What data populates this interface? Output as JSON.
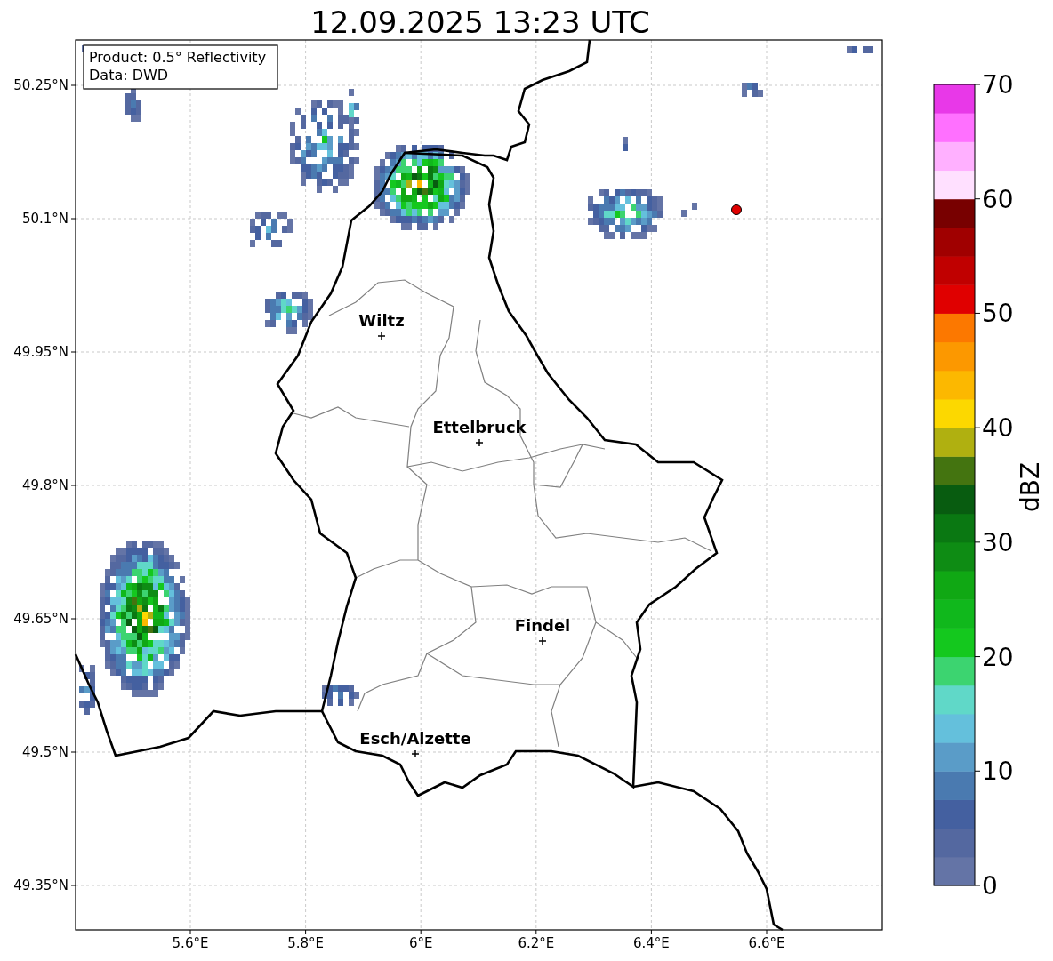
{
  "title": "12.09.2025 13:23 UTC",
  "info_box": [
    "Product: 0.5° Reflectivity",
    "Data: DWD"
  ],
  "map": {
    "xticks": [
      "5.6°E",
      "5.8°E",
      "6°E",
      "6.2°E",
      "6.4°E",
      "6.6°E"
    ],
    "yticks": [
      "50.25°N",
      "50.1°N",
      "49.95°N",
      "49.8°N",
      "49.65°N",
      "49.5°N",
      "49.35°N"
    ],
    "cities": [
      {
        "name": "Wiltz"
      },
      {
        "name": "Ettelbruck"
      },
      {
        "name": "Findel"
      },
      {
        "name": "Esch/Alzette"
      }
    ],
    "radar_site": {
      "color": "#e00000"
    }
  },
  "colorbar": {
    "label": "dBZ",
    "ticks": [
      "70",
      "60",
      "50",
      "40",
      "30",
      "20",
      "10",
      "0"
    ],
    "bins": [
      {
        "color": "#6474a6"
      },
      {
        "color": "#5468a0"
      },
      {
        "color": "#4460a0"
      },
      {
        "color": "#4a7ab0"
      },
      {
        "color": "#5a9cc8"
      },
      {
        "color": "#64c0dc"
      },
      {
        "color": "#60d8c8"
      },
      {
        "color": "#3cd470"
      },
      {
        "color": "#14c81e"
      },
      {
        "color": "#10b81c"
      },
      {
        "color": "#10a814"
      },
      {
        "color": "#0e8c14"
      },
      {
        "color": "#0a7812"
      },
      {
        "color": "#085c10"
      },
      {
        "color": "#447410"
      },
      {
        "color": "#b0b010"
      },
      {
        "color": "#fcd800"
      },
      {
        "color": "#fcb800"
      },
      {
        "color": "#fc9800"
      },
      {
        "color": "#fc7800"
      },
      {
        "color": "#e00000"
      },
      {
        "color": "#c00000"
      },
      {
        "color": "#a00000"
      },
      {
        "color": "#780000"
      },
      {
        "color": "#ffe0ff"
      },
      {
        "color": "#ffb0ff"
      },
      {
        "color": "#ff70ff"
      },
      {
        "color": "#e838e8"
      }
    ]
  }
}
